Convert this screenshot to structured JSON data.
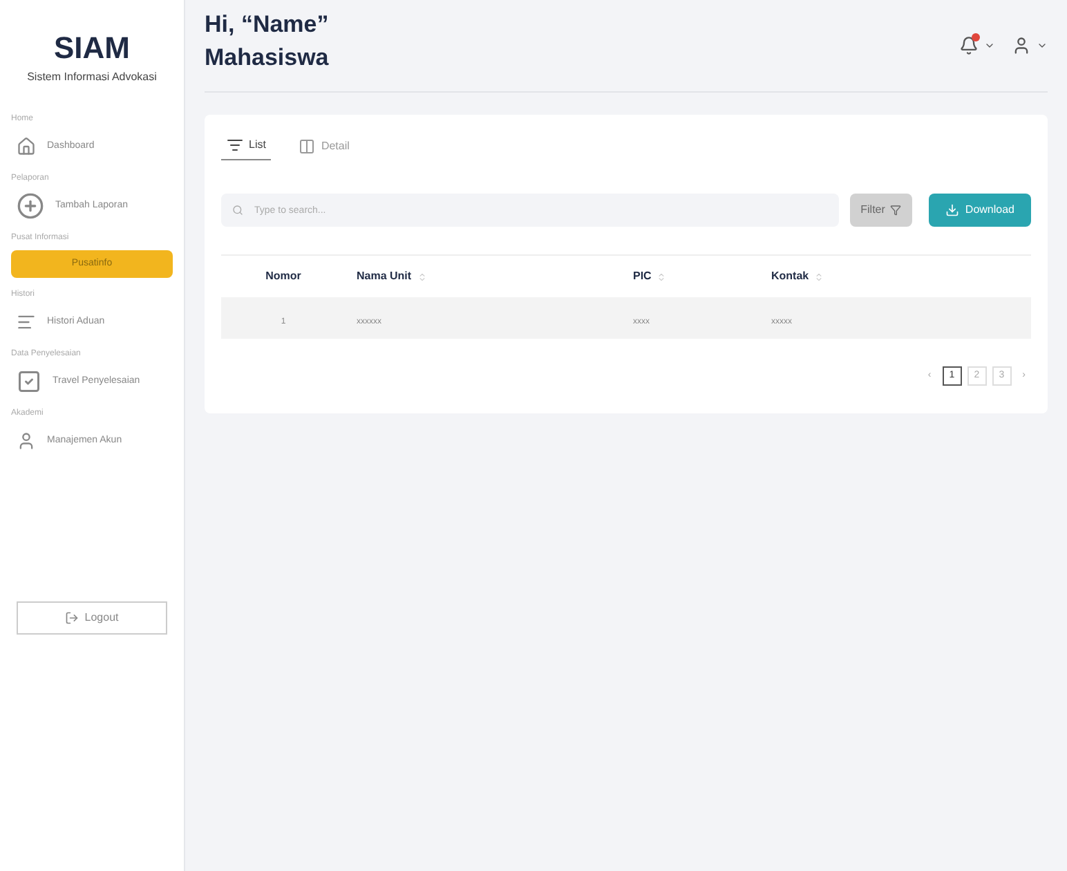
{
  "brand": {
    "title": "SIAM",
    "subtitle": "Sistem Informasi Advokasi"
  },
  "sidebar": {
    "sections": [
      {
        "label": "Home",
        "items": [
          {
            "kind": "home",
            "label": "Dashboard",
            "selected": false
          }
        ]
      },
      {
        "label": "Pelaporan",
        "items": [
          {
            "kind": "plus",
            "label": "Tambah Laporan",
            "selected": false
          }
        ]
      },
      {
        "label": "Pusat Informasi",
        "items": [
          {
            "kind": "none",
            "label": "Pusatinfo",
            "selected": true
          }
        ]
      },
      {
        "label": "Histori",
        "items": [
          {
            "kind": "list",
            "label": "Histori Aduan",
            "selected": false
          }
        ]
      },
      {
        "label": "Data Penyelesaian",
        "items": [
          {
            "kind": "check",
            "label": "Travel Penyelesaian",
            "selected": false
          }
        ]
      },
      {
        "label": "Akademi",
        "items": [
          {
            "kind": "user",
            "label": "Manajemen Akun",
            "selected": false
          }
        ]
      }
    ],
    "logout": "Logout"
  },
  "header": {
    "greeting": "Hi, “Name”",
    "role": "Mahasiswa",
    "notification": true
  },
  "tabs": [
    {
      "kind": "list",
      "label": "List",
      "selected": true
    },
    {
      "kind": "detail",
      "label": "Detail",
      "selected": false
    }
  ],
  "search": {
    "placeholder": "Type to search..."
  },
  "filter_button": "Filter",
  "download_button": "Download",
  "table": {
    "columns": [
      {
        "label": "Nomor",
        "sortable": false
      },
      {
        "label": "Nama Unit",
        "sortable": true
      },
      {
        "label": "PIC",
        "sortable": true
      },
      {
        "label": "Kontak",
        "sortable": true
      }
    ],
    "rows": [
      [
        "1",
        "xxxxxx",
        "xxxx",
        "xxxxx"
      ]
    ]
  },
  "pagination": {
    "prev": "‹",
    "pages": [
      {
        "label": "1",
        "selected": true
      },
      {
        "label": "2",
        "selected": false
      },
      {
        "label": "3",
        "selected": false
      }
    ],
    "next": "›"
  }
}
